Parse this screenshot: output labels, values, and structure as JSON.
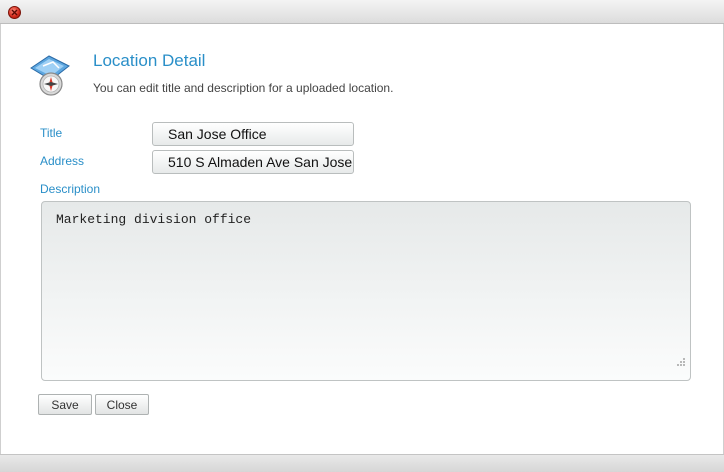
{
  "window": {
    "close_icon": "close-icon"
  },
  "header": {
    "icon": "map-compass-icon",
    "title": "Location Detail",
    "subtitle": "You can edit title and description for a uploaded location."
  },
  "form": {
    "title_label": "Title",
    "title_value": "San Jose Office",
    "address_label": "Address",
    "address_value": "510 S Almaden Ave San Jose",
    "description_label": "Description",
    "description_value": "Marketing division office"
  },
  "buttons": {
    "save_label": "Save",
    "close_label": "Close"
  },
  "colors": {
    "accent": "#2a8fc8",
    "close_red": "#d0281a"
  }
}
